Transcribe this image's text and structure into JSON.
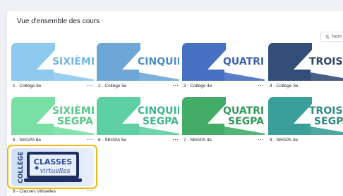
{
  "panel": {
    "title": "Vue d'ensemble des cours"
  },
  "sort": {
    "label": "Nom",
    "icon": "sort-icon"
  },
  "menu_glyph": "…",
  "courses": [
    {
      "name": "1 - Collège 6e",
      "line1": "SIXIÈME",
      "line2": "",
      "bg": "#8ec9ee",
      "zfill": "#8ec9ee",
      "text_color": "#6fb6e6"
    },
    {
      "name": "2 - Collège 5e",
      "line1": "CINQUIÈMI",
      "line2": "",
      "bg": "#6fa6d8",
      "zfill": "#6fa6d8",
      "text_color": "#4d8cc6"
    },
    {
      "name": "3 - Collège 4e",
      "line1": "QUATRIÈM",
      "line2": "",
      "bg": "#4670c2",
      "zfill": "#4670c2",
      "text_color": "#3b62b3"
    },
    {
      "name": "4 - Collège 3e",
      "line1": "TROISIÈ",
      "line2": "",
      "bg": "#334e78",
      "zfill": "#334e78",
      "text_color": "#2c446b"
    },
    {
      "name": "5 - SEGPA 6e",
      "line1": "SIXIÈME",
      "line2": "SEGPA",
      "bg": "#79e0a4",
      "zfill": "#79e0a4",
      "text_color": "#57c987"
    },
    {
      "name": "6 - SEGPA 5e",
      "line1": "CINQUIÈMI",
      "line2": "SEGPA",
      "bg": "#5dcfa2",
      "zfill": "#5dcfa2",
      "text_color": "#3fb78a"
    },
    {
      "name": "7 - SEGPA 4e",
      "line1": "QUATRIÈM",
      "line2": "SEGPA",
      "bg": "#43ad68",
      "zfill": "#43ad68",
      "text_color": "#35995a"
    },
    {
      "name": "8 - SEGPA 3e",
      "line1": "TROISIÈ",
      "line2": "SEGPA",
      "bg": "#3a9f98",
      "zfill": "#3a9f98",
      "text_color": "#2e8a84"
    }
  ],
  "virtual": {
    "name": "9 - Classes Virtuelles",
    "side_text": "COLLÈGE",
    "title": "CLASSES",
    "subtitle": "virtuelles",
    "accent": "#f3b70f"
  }
}
